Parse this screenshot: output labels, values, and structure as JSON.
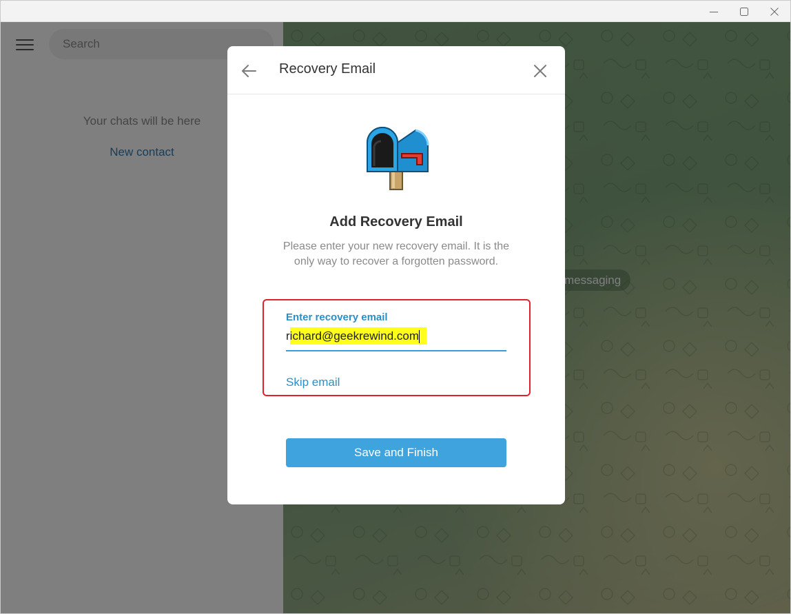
{
  "window": {
    "controls": [
      "minimize",
      "maximize",
      "close"
    ]
  },
  "sidebar": {
    "search_placeholder": "Search",
    "empty_text": "Your chats will be here",
    "new_contact": "New contact"
  },
  "chat": {
    "badge_text": "messaging"
  },
  "dialog": {
    "title": "Recovery Email",
    "heading": "Add Recovery Email",
    "description": "Please enter your new recovery email. It is the only way to recover a forgotten password.",
    "email_label": "Enter recovery email",
    "email_value_prefix": "r",
    "email_value_highlighted": "ichard@geekrewind.com",
    "skip_label": "Skip email",
    "save_label": "Save and Finish"
  },
  "colors": {
    "accent": "#3fa3de",
    "link": "#2b8fc6",
    "annotation_box": "#e0202a",
    "text_highlight": "#ffff1a"
  },
  "icons": {
    "menu": "hamburger-icon",
    "back": "arrow-left-icon",
    "close": "close-icon",
    "illustration": "mailbox-icon"
  }
}
